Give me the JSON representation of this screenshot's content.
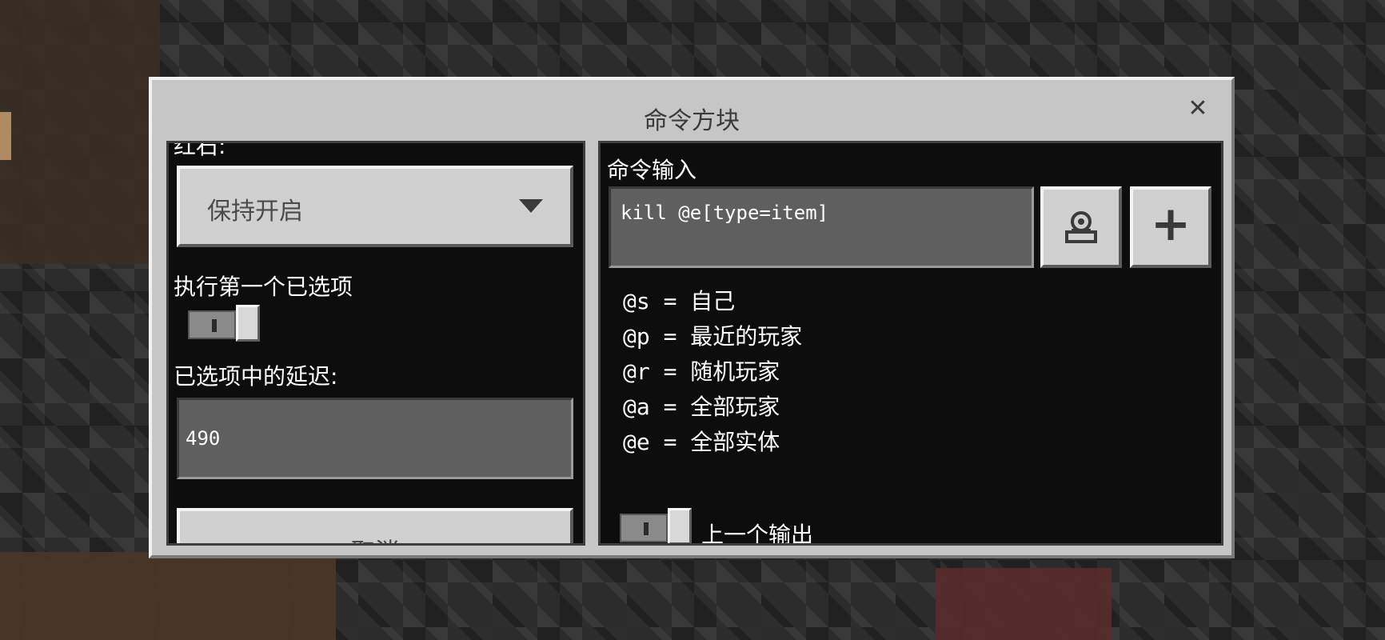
{
  "dialog": {
    "title": "命令方块",
    "close_glyph": "✕"
  },
  "left_panel": {
    "top_cut_label": "红石:",
    "redstone_mode_value": "保持开启",
    "execute_first_label": "执行第一个已选项",
    "delay_label": "已选项中的延迟:",
    "delay_value": "490",
    "cancel_label": "取消"
  },
  "right_panel": {
    "command_label": "命令输入",
    "command_value": "kill @e[type=item]",
    "selectors": [
      "@s = 自己",
      "@p = 最近的玩家",
      "@r = 随机玩家",
      "@a = 全部玩家",
      "@e = 全部实体"
    ],
    "previous_output_label": "上一个输出",
    "add_glyph": "+"
  },
  "icons": {
    "close": "close-icon",
    "dropdown": "chevron-down-icon",
    "entity": "entity-selector-icon",
    "add": "plus-icon"
  }
}
